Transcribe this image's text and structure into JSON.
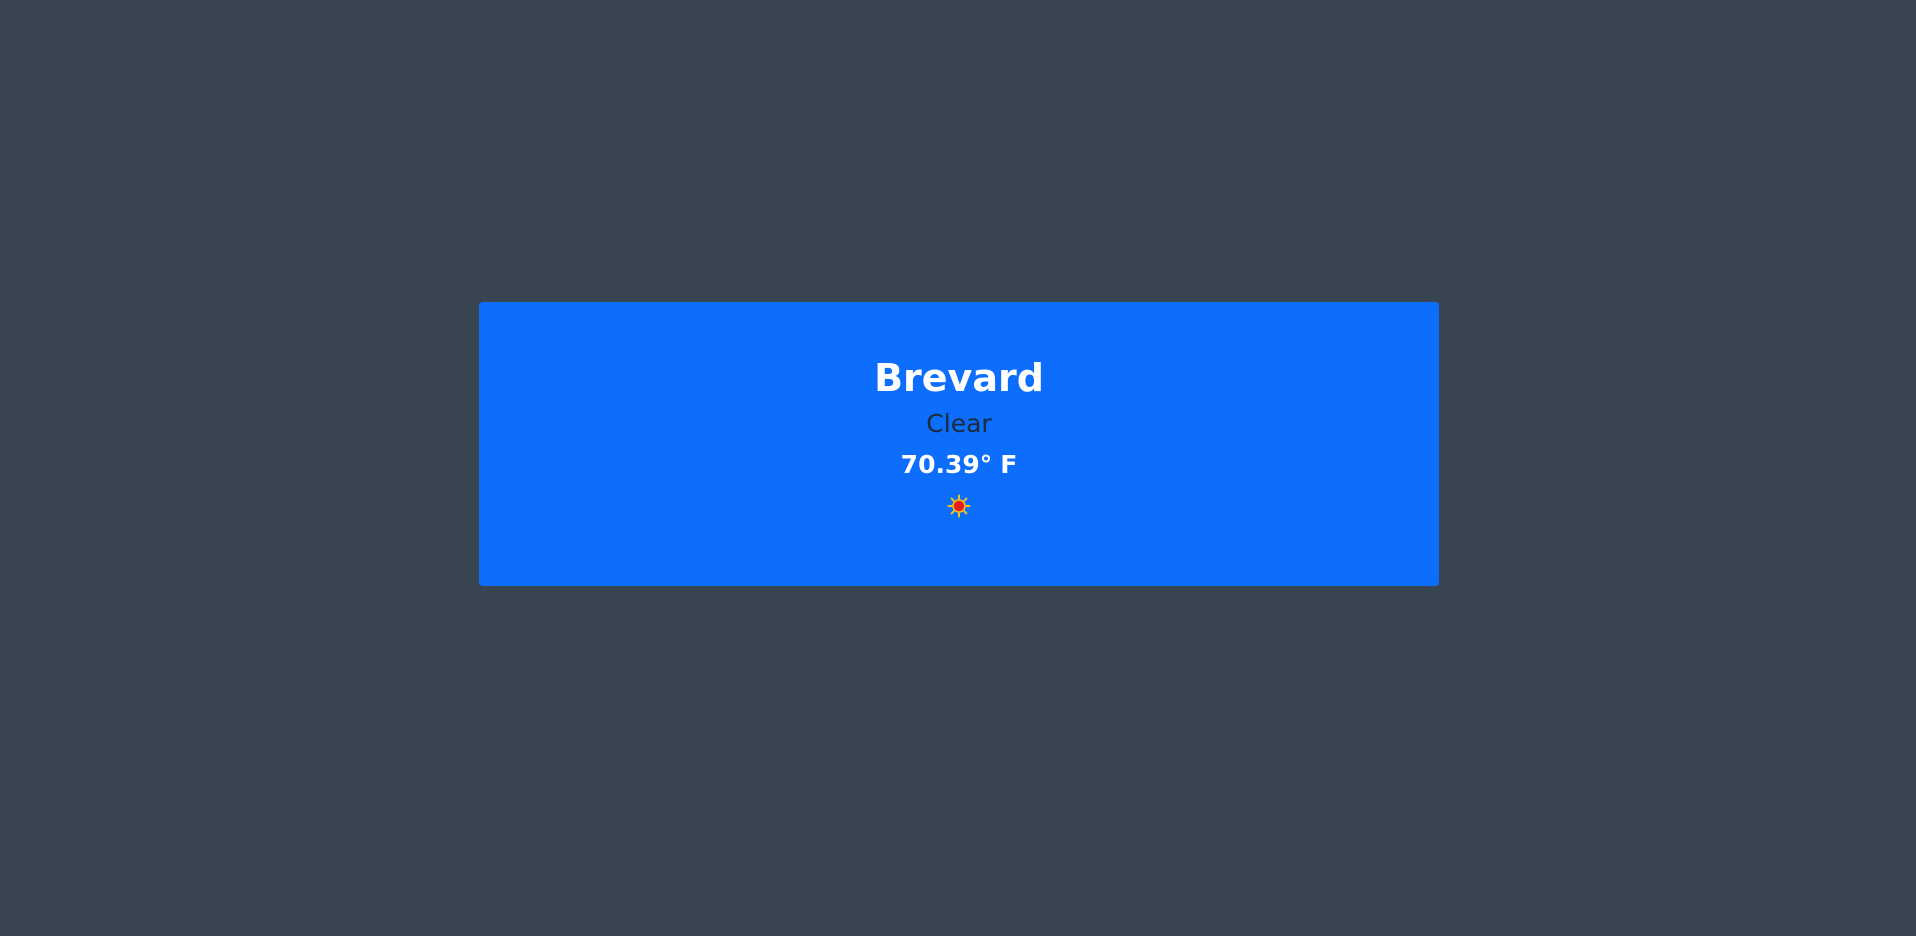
{
  "weather": {
    "city": "Brevard",
    "condition": "Clear",
    "temperature": "70.39°",
    "unit": "F",
    "icon": "sun-icon"
  },
  "colors": {
    "background": "#384550",
    "card": "#0d6efd",
    "condition_text": "#1c2a3a",
    "sun_core": "#e8201c",
    "sun_rays": "#f6c21a"
  }
}
